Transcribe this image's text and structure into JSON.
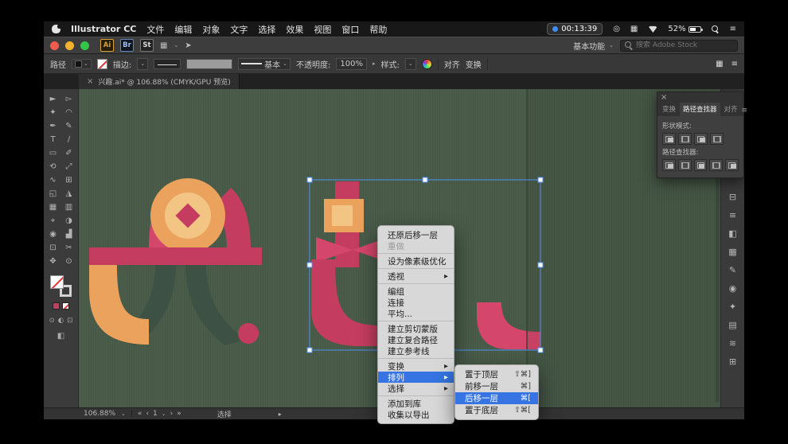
{
  "colors": {
    "canvas_green": "#4a5c4a",
    "crimson": "#c43d60",
    "pink": "#d4466b",
    "orange": "#eba25c",
    "light_orange": "#f3c584",
    "dark_green": "#3d5244",
    "selection_blue": "#4f93f7",
    "menu_highlight": "#3574e2"
  },
  "menubar": {
    "app_name": "Illustrator CC",
    "menus": [
      "文件",
      "编辑",
      "对象",
      "文字",
      "选择",
      "效果",
      "视图",
      "窗口",
      "帮助"
    ],
    "timer": "00:13:39",
    "battery": "52%"
  },
  "titlebar": {
    "ai_logo": "Ai",
    "bridge": "Br",
    "stock": "St",
    "workspace": "基本功能",
    "search_placeholder": "搜索 Adobe Stock"
  },
  "controlbar": {
    "selection_label": "路径",
    "stroke_label": "描边:",
    "brush_name": "基本",
    "opacity_label": "不透明度:",
    "opacity_value": "100%",
    "style_label": "样式:",
    "align": "对齐",
    "transform": "变换"
  },
  "doc_tab": {
    "title": "兴趣.ai* @ 106.88% (CMYK/GPU 预览)"
  },
  "toolbar": {
    "tools": [
      "►",
      "▻",
      "✦",
      "◠",
      "✒",
      "✎",
      "T",
      "∕",
      "▭",
      "✐",
      "⟲",
      "⤢",
      "∿",
      "⊞",
      "◱",
      "◮",
      "▦",
      "▥",
      "⌖",
      "◑",
      "◉",
      "▟",
      "⊡",
      "✂",
      "✥",
      "⊙"
    ],
    "draw_modes": [
      "⊙",
      "◐",
      "⊡"
    ],
    "screen_mode": "◧"
  },
  "rightstrip": {
    "icons": [
      "⊟",
      "≡",
      "◧",
      "▦",
      "✎",
      "◉",
      "✦",
      "▤",
      "≋",
      "⊞"
    ]
  },
  "panel": {
    "tabs": [
      "变换",
      "路径查找器",
      "对齐"
    ],
    "shape_mode_label": "形状模式:",
    "pathfinder_label": "路径查找器:"
  },
  "context_menu": {
    "items": [
      "还原后移一层",
      "重做",
      "设为像素级优化",
      "透视",
      "编组",
      "连接",
      "平均...",
      "建立剪切蒙版",
      "建立复合路径",
      "建立参考线",
      "变换",
      "排列",
      "选择",
      "添加到库",
      "收集以导出"
    ]
  },
  "submenu": {
    "items": [
      {
        "label": "置于顶层",
        "shortcut": "⇧⌘]"
      },
      {
        "label": "前移一层",
        "shortcut": "⌘]"
      },
      {
        "label": "后移一层",
        "shortcut": "⌘["
      },
      {
        "label": "置于底层",
        "shortcut": "⇧⌘["
      }
    ]
  },
  "statusbar": {
    "zoom": "106.88%",
    "artboard": "1",
    "tool": "选择"
  },
  "icons": {
    "chevron_down": "⌄",
    "chevron_right": "▸",
    "submenu_arrow": "▶",
    "close": "×",
    "hamburger": "≡",
    "display": "◎",
    "keyboard": "▦",
    "grid": "▦",
    "send": "➤",
    "nav_first": "«",
    "nav_prev": "‹",
    "nav_next": "›",
    "nav_last": "»"
  }
}
